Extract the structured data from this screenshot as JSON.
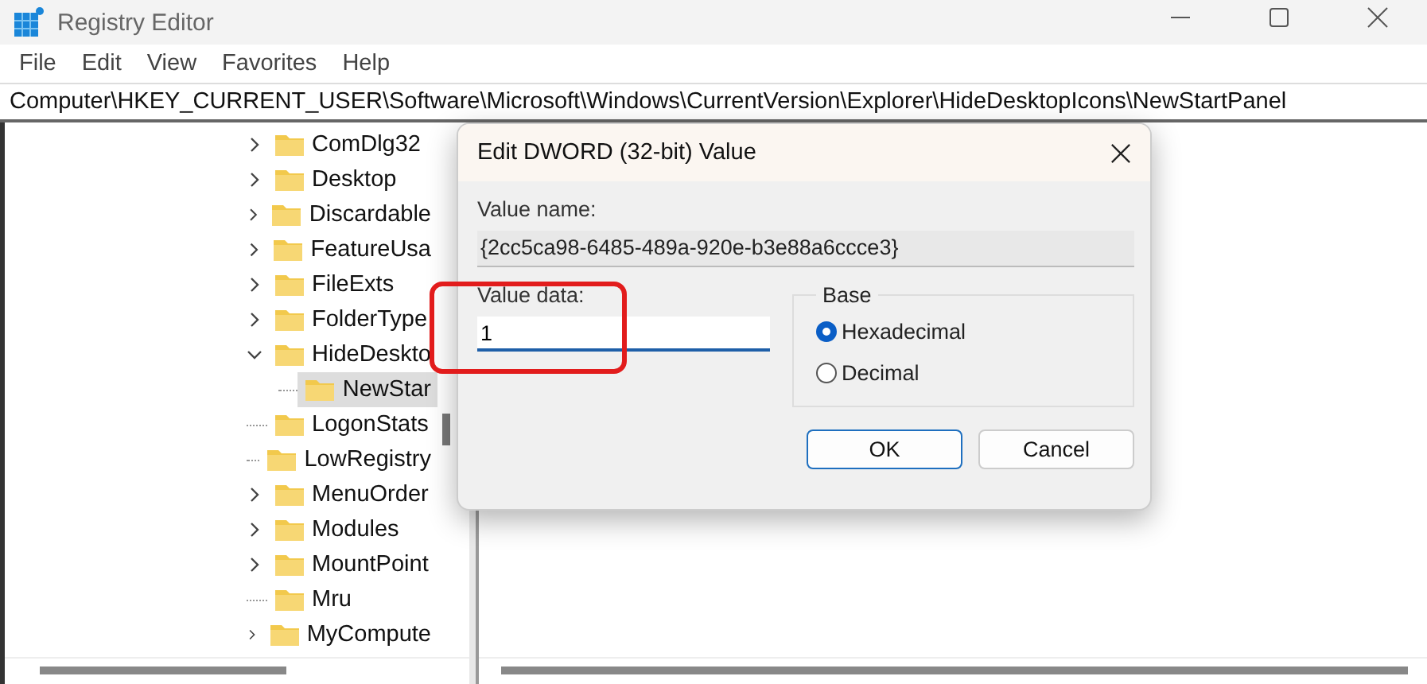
{
  "window": {
    "title": "Registry Editor"
  },
  "menu": [
    "File",
    "Edit",
    "View",
    "Favorites",
    "Help"
  ],
  "address": "Computer\\HKEY_CURRENT_USER\\Software\\Microsoft\\Windows\\CurrentVersion\\Explorer\\HideDesktopIcons\\NewStartPanel",
  "tree": [
    {
      "label": "ComDlg32",
      "kind": "expandable",
      "expanded": false,
      "selected": false
    },
    {
      "label": "Desktop",
      "kind": "expandable",
      "expanded": false,
      "selected": false
    },
    {
      "label": "Discardable",
      "kind": "expandable",
      "expanded": false,
      "selected": false
    },
    {
      "label": "FeatureUsa",
      "kind": "expandable",
      "expanded": false,
      "selected": false
    },
    {
      "label": "FileExts",
      "kind": "expandable",
      "expanded": false,
      "selected": false
    },
    {
      "label": "FolderType",
      "kind": "expandable",
      "expanded": false,
      "selected": false
    },
    {
      "label": "HideDeskto",
      "kind": "expandable",
      "expanded": true,
      "selected": false,
      "children": [
        {
          "label": "NewStar",
          "kind": "leaf",
          "selected": true
        }
      ]
    },
    {
      "label": "LogonStats",
      "kind": "leaf",
      "selected": false
    },
    {
      "label": "LowRegistry",
      "kind": "leaf",
      "selected": false
    },
    {
      "label": "MenuOrder",
      "kind": "expandable",
      "expanded": false,
      "selected": false
    },
    {
      "label": "Modules",
      "kind": "expandable",
      "expanded": false,
      "selected": false
    },
    {
      "label": "MountPoint",
      "kind": "expandable",
      "expanded": false,
      "selected": false
    },
    {
      "label": "Mru",
      "kind": "leaf",
      "selected": false
    },
    {
      "label": "MyCompute",
      "kind": "expandable",
      "expanded": false,
      "selected": false
    }
  ],
  "dialog": {
    "title": "Edit DWORD (32-bit) Value",
    "value_name_label": "Value name:",
    "value_name": "{2cc5ca98-6485-489a-920e-b3e88a6ccce3}",
    "value_data_label": "Value data:",
    "value_data": "1",
    "base_label": "Base",
    "base_options": [
      {
        "label": "Hexadecimal",
        "selected": true
      },
      {
        "label": "Decimal",
        "selected": false
      }
    ],
    "buttons": [
      {
        "label": "OK",
        "default": true
      },
      {
        "label": "Cancel",
        "default": false
      }
    ]
  }
}
